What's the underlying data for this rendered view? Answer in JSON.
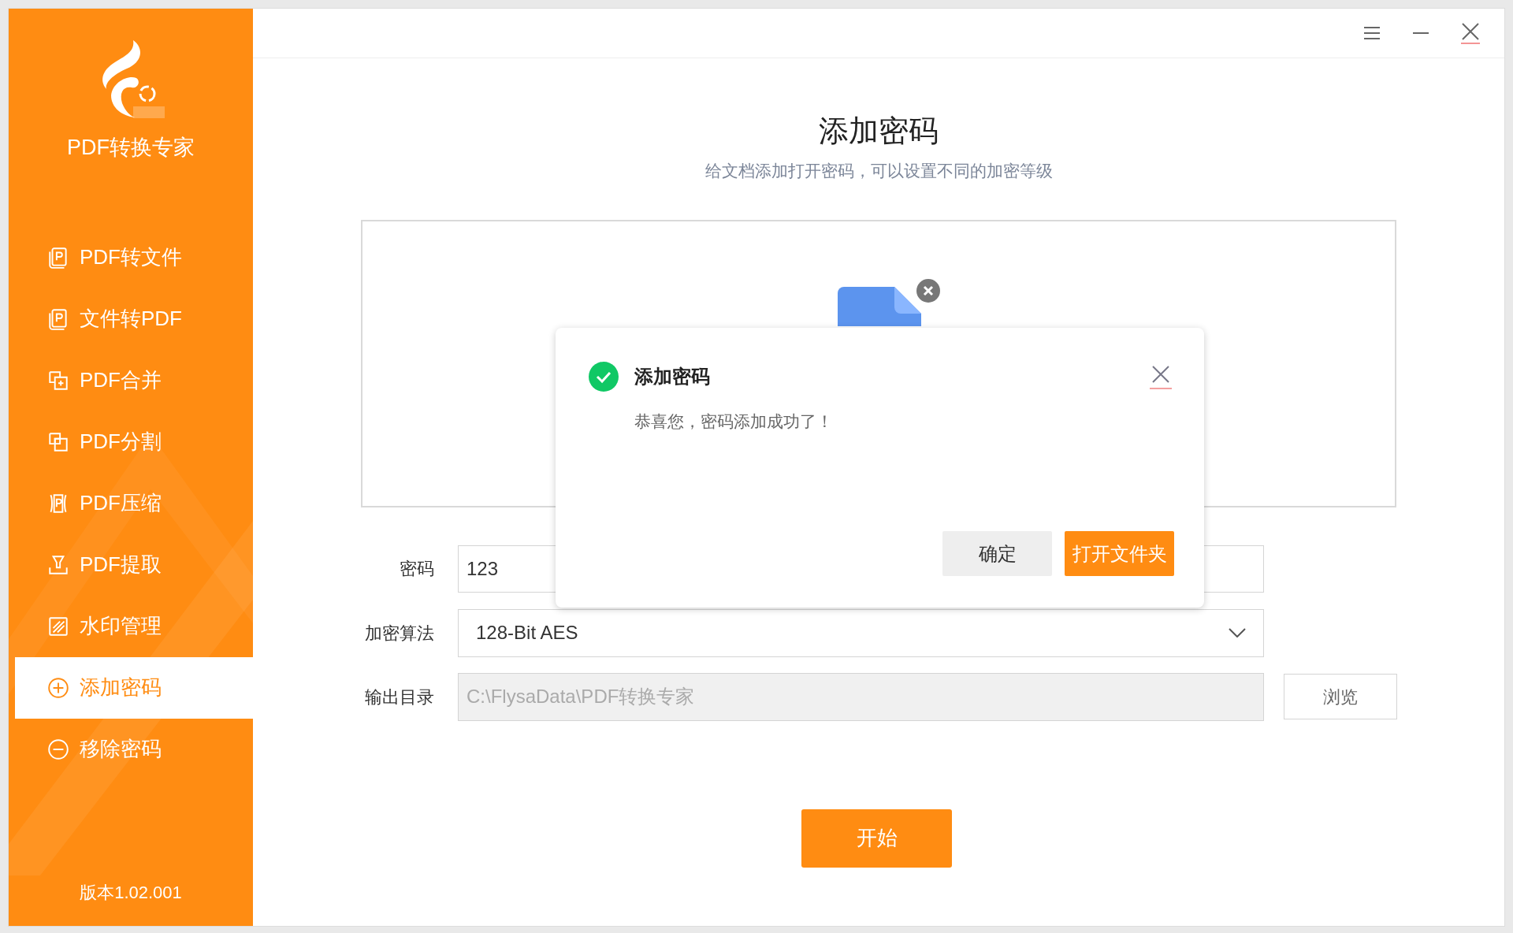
{
  "app": {
    "name": "PDF转换专家",
    "version": "版本1.02.001"
  },
  "sidebar": {
    "items": [
      {
        "label": "PDF转文件",
        "selected": false
      },
      {
        "label": "文件转PDF",
        "selected": false
      },
      {
        "label": "PDF合并",
        "selected": false
      },
      {
        "label": "PDF分割",
        "selected": false
      },
      {
        "label": "PDF压缩",
        "selected": false
      },
      {
        "label": "PDF提取",
        "selected": false
      },
      {
        "label": "水印管理",
        "selected": false
      },
      {
        "label": "添加密码",
        "selected": true
      },
      {
        "label": "移除密码",
        "selected": false
      }
    ]
  },
  "page": {
    "title": "添加密码",
    "subtitle": "给文档添加打开密码，可以设置不同的加密等级"
  },
  "form": {
    "password": {
      "label": "密码",
      "value": "123"
    },
    "algorithm": {
      "label": "加密算法",
      "value": "128-Bit AES"
    },
    "output": {
      "label": "输出目录",
      "value": "C:\\FlysaData\\PDF转换专家",
      "disabled": true,
      "browse": "浏览"
    },
    "start": "开始"
  },
  "dialog": {
    "title": "添加密码",
    "message": "恭喜您，密码添加成功了！",
    "buttons": [
      {
        "label": "确定",
        "kind": "secondary"
      },
      {
        "label": "打开文件夹",
        "kind": "primary"
      }
    ]
  }
}
